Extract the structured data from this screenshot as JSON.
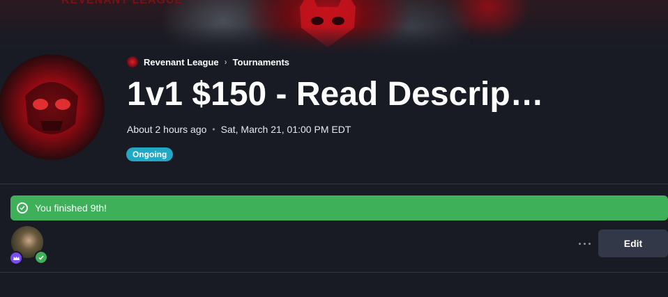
{
  "banner": {
    "text": "REVENANT LEAGUE"
  },
  "breadcrumb": {
    "org": "Revenant League",
    "section": "Tournaments"
  },
  "tournament": {
    "title": "1v1 $150 - Read Descrip…",
    "relative_time": "About 2 hours ago",
    "date": "Sat, March 21, 01:00 PM EDT",
    "status": "Ongoing"
  },
  "result": {
    "message": "You finished 9th!"
  },
  "actions": {
    "edit_label": "Edit"
  },
  "colors": {
    "accent_teal": "#21a8c5",
    "success_green": "#3fb05a",
    "brand_red": "#d4121c",
    "background": "#191b24"
  },
  "icons": [
    "check-circle-icon",
    "chevron-right-icon",
    "crown-icon",
    "check-icon",
    "more-icon"
  ]
}
